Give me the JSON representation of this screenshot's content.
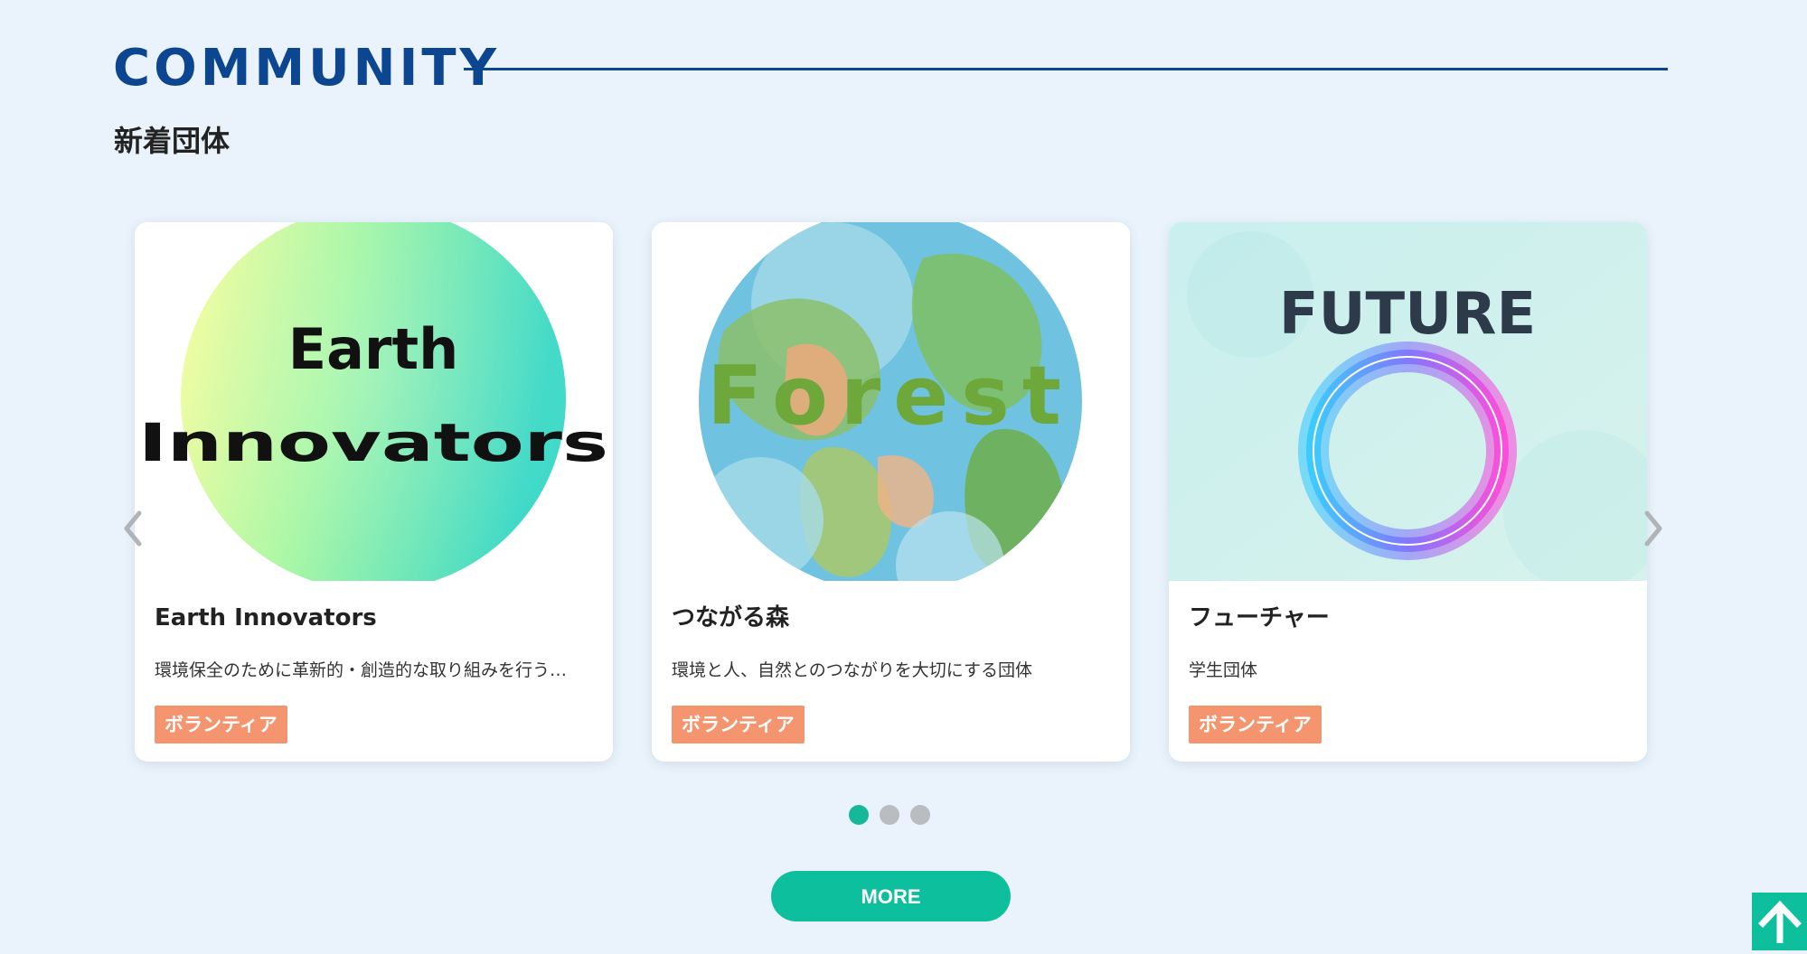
{
  "section": {
    "title": "COMMUNITY",
    "subtitle": "新着団体"
  },
  "cards": [
    {
      "name": "Earth Innovators",
      "description": "環境保全のために革新的・創造的な取り組みを行う…",
      "tag": "ボランティア",
      "logo_lines": [
        "Earth",
        "Innovators"
      ]
    },
    {
      "name": "つながる森",
      "description": "環境と人、自然とのつながりを大切にする団体",
      "tag": "ボランティア",
      "logo_text": "Forest"
    },
    {
      "name": "フューチャー",
      "description": "学生団体",
      "tag": "ボランティア",
      "logo_text": "FUTURE"
    }
  ],
  "carousel": {
    "active_page": 1,
    "page_count": 3,
    "prev_icon": "chevron-left-icon",
    "next_icon": "chevron-right-icon"
  },
  "more_button": {
    "label": "MORE"
  },
  "scroll_top": {
    "icon": "arrow-up-icon"
  },
  "colors": {
    "background": "#eaf3fb",
    "title": "#0c4690",
    "accent": "#0dbf9d",
    "tag": "#f5956f",
    "dot_inactive": "#b9bdc0"
  }
}
